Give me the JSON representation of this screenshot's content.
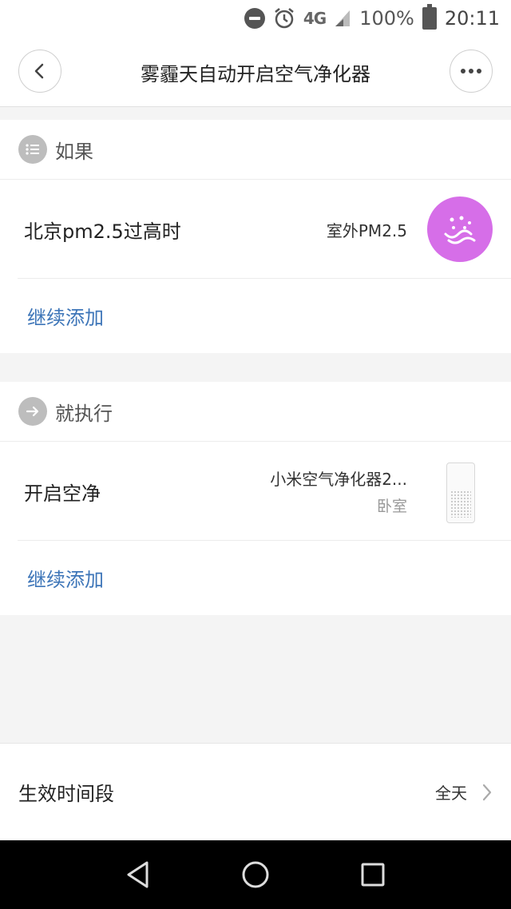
{
  "status_bar": {
    "network": "4G",
    "battery": "100%",
    "time": "20:11"
  },
  "header": {
    "title": "雾霾天自动开启空气净化器",
    "back_icon": "chevron-left-icon",
    "more_icon": "more-dots-icon"
  },
  "if_section": {
    "label": "如果",
    "icon": "list-icon",
    "condition": {
      "title": "北京pm2.5过高时",
      "source": "室外PM2.5",
      "icon": "pm25-face-icon",
      "icon_color": "#d66ee8"
    },
    "add_label": "继续添加"
  },
  "then_section": {
    "label": "就执行",
    "icon": "arrow-right-icon",
    "action": {
      "title": "开启空净",
      "device_name": "小米空气净化器2...",
      "device_room": "卧室",
      "icon": "air-purifier-icon"
    },
    "add_label": "继续添加"
  },
  "time_period": {
    "label": "生效时间段",
    "value": "全天"
  },
  "colors": {
    "link": "#3d75b8",
    "accent": "#d66ee8"
  }
}
